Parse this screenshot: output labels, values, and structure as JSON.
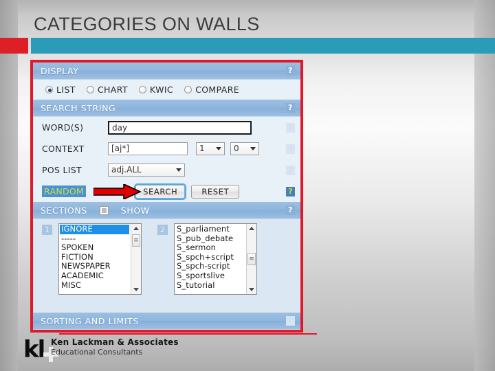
{
  "slide": {
    "title": "CATEGORIES ON WALLS",
    "accent_red": "#dd2026",
    "accent_teal": "#2b9cb8"
  },
  "app": {
    "border_color": "#e2182a",
    "display": {
      "header": "DISPLAY",
      "help": "?",
      "options": [
        {
          "label": "LIST",
          "checked": true
        },
        {
          "label": "CHART",
          "checked": false
        },
        {
          "label": "KWIC",
          "checked": false
        },
        {
          "label": "COMPARE",
          "checked": false
        }
      ]
    },
    "search_string": {
      "header": "SEARCH STRING",
      "help": "?",
      "words": {
        "label": "WORD(S)",
        "value": "day",
        "placeholder": ""
      },
      "context": {
        "label": "CONTEXT",
        "value": "[aj*]",
        "left_span": "1",
        "right_span": "0"
      },
      "pos_list": {
        "label": "POS LIST",
        "value": "adj.ALL"
      },
      "random_label": "RANDOM",
      "search_button": "SEARCH",
      "reset_button": "RESET"
    },
    "sections": {
      "header": "SECTIONS",
      "show_label": "SHOW",
      "help": "?",
      "badge_1": "1",
      "badge_2": "2",
      "list_1": [
        "IGNORE",
        "-----",
        "SPOKEN",
        "FICTION",
        "NEWSPAPER",
        "ACADEMIC",
        "MISC"
      ],
      "list_1_selected": "IGNORE",
      "list_2": [
        "S_parliament",
        "S_pub_debate",
        "S_sermon",
        "S_spch+script",
        "S_spch-script",
        "S_sportslive",
        "S_tutorial"
      ]
    },
    "sorting": {
      "header": "SORTING AND LIMITS",
      "help": "?"
    }
  },
  "footer": {
    "logo": "kl",
    "name": "Ken Lackman & Associates",
    "subtitle": "Educational Consultants"
  }
}
